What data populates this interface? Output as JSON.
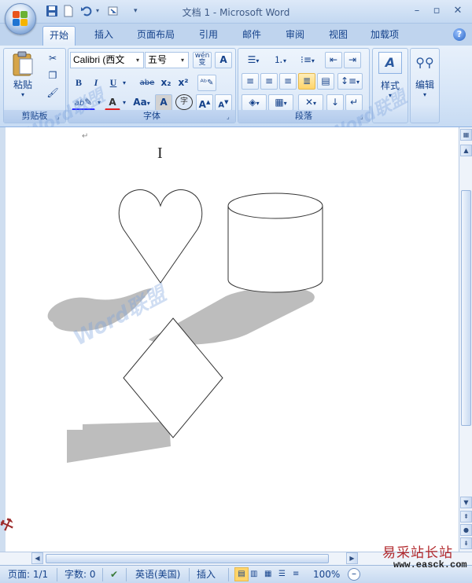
{
  "window": {
    "title": "文档 1 - Microsoft Word",
    "minimize": "–",
    "restore": "▫",
    "close": "✕"
  },
  "quick_access": [
    "save-icon",
    "new-doc-icon",
    "undo-icon",
    "redo-icon",
    "customize-icon"
  ],
  "tabs": [
    {
      "label": "开始",
      "active": true
    },
    {
      "label": "插入"
    },
    {
      "label": "页面布局"
    },
    {
      "label": "引用"
    },
    {
      "label": "邮件"
    },
    {
      "label": "审阅"
    },
    {
      "label": "视图"
    },
    {
      "label": "加载项"
    }
  ],
  "ribbon": {
    "clipboard": {
      "label": "剪贴板",
      "paste": "粘贴"
    },
    "font": {
      "label": "字体",
      "font_name": "Calibri (西文",
      "font_size": "五号",
      "bold": "B",
      "italic": "I",
      "underline": "U",
      "strike": "abe",
      "sub": "x₂",
      "sup": "x²",
      "grow": "A",
      "shrink": "A",
      "case": "Aa",
      "char_border": "A",
      "enclose": "字",
      "wen": "wén"
    },
    "paragraph": {
      "label": "段落"
    },
    "styles": {
      "label": "样式"
    },
    "editing": {
      "label": "编辑"
    }
  },
  "document": {
    "paragraph_mark": "↵",
    "cursor": "I"
  },
  "watermark": "Word联盟",
  "statusbar": {
    "page": "页面: 1/1",
    "words": "字数: 0",
    "language": "英语(美国)",
    "mode": "插入",
    "zoom": "100%"
  },
  "site": {
    "name": "易采站长站",
    "url": "www.easck.com"
  },
  "colors": {
    "accent": "#15428b",
    "shape_stroke": "#333333",
    "shadow": "#bdbdbd",
    "highlight": "#ffd46a"
  }
}
